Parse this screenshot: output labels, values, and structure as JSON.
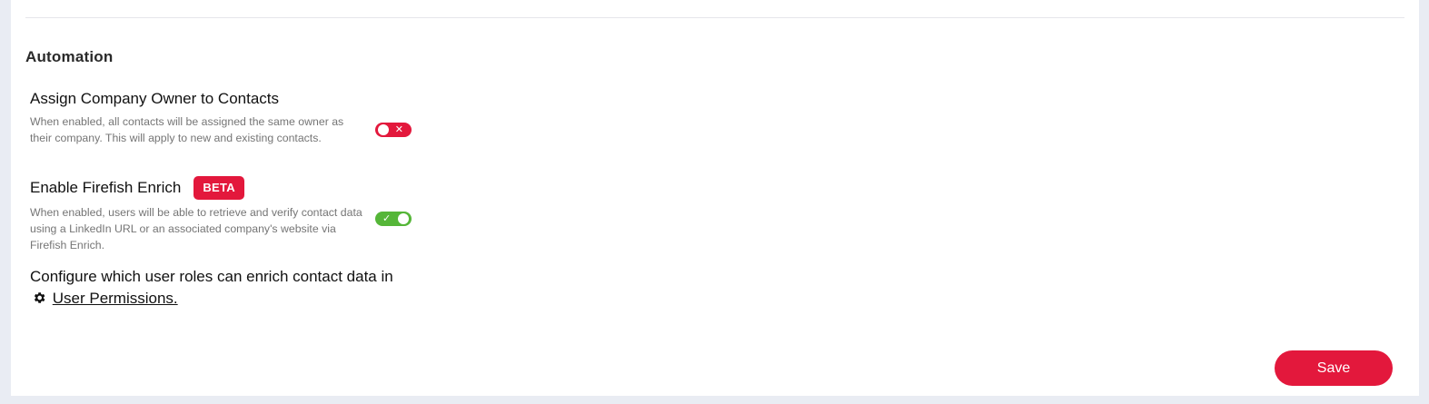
{
  "section": {
    "title": "Automation"
  },
  "settings": [
    {
      "title": "Assign Company Owner to Contacts",
      "description": "When enabled, all contacts will be assigned the same owner as their company. This will apply to new and existing contacts.",
      "enabled": false,
      "toggle_glyph": "✕"
    },
    {
      "title": "Enable Firefish Enrich",
      "badge": "BETA",
      "description": "When enabled, users will be able to retrieve and verify contact data using a LinkedIn URL or an associated company's website via Firefish Enrich.",
      "enabled": true,
      "toggle_glyph": "✓"
    }
  ],
  "permissions": {
    "text": "Configure which user roles can enrich contact data in",
    "link_label": "User Permissions.",
    "icon": "gear-icon"
  },
  "footer": {
    "save_label": "Save"
  },
  "colors": {
    "accent": "#e3183c",
    "toggle_on": "#55b638",
    "background": "#e9ecf3",
    "panel": "#ffffff"
  }
}
